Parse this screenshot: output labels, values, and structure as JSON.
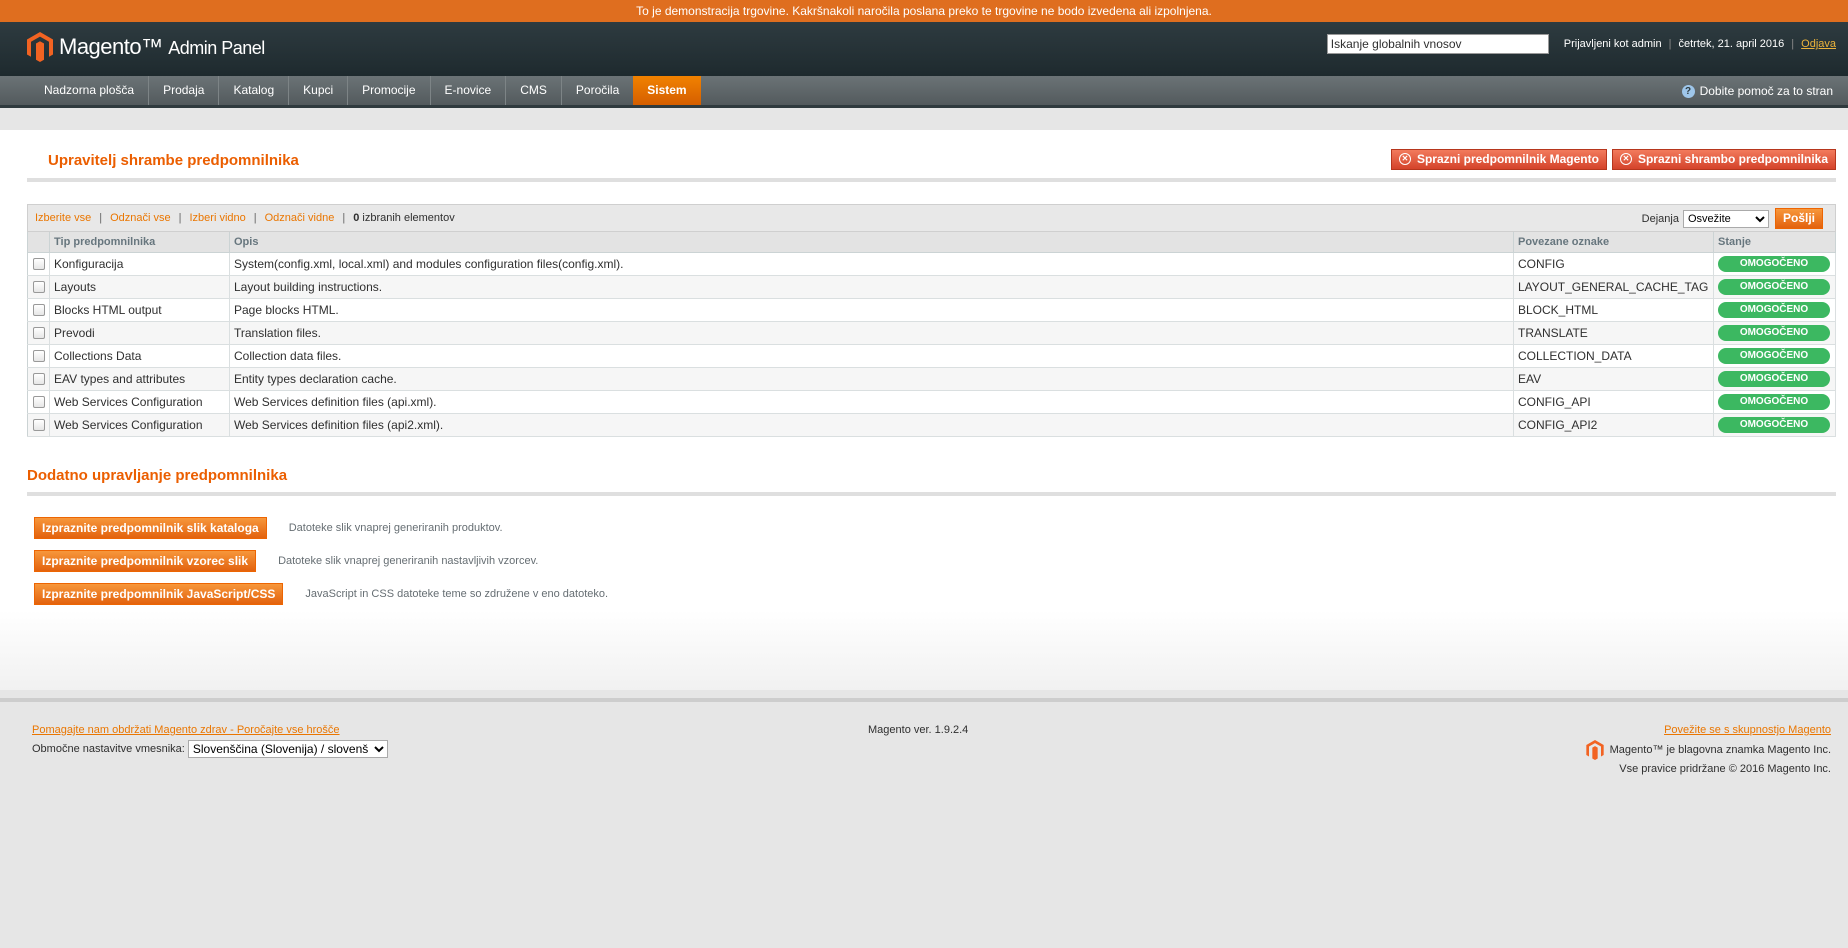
{
  "demo_notice": "To je demonstracija trgovine. Kakršnakoli naročila poslana preko te trgovine ne bodo izvedena ali izpolnjena.",
  "header": {
    "logo_brand": "Magento",
    "logo_sub": "Admin Panel",
    "search_value": "Iskanje globalnih vnosov",
    "logged_in": "Prijavljeni kot admin",
    "date": "četrtek, 21. april 2016",
    "logout": "Odjava"
  },
  "nav": {
    "items": [
      "Nadzorna plošča",
      "Prodaja",
      "Katalog",
      "Kupci",
      "Promocije",
      "E-novice",
      "CMS",
      "Poročila",
      "Sistem"
    ],
    "active": "Sistem",
    "help": "Dobite pomoč za to stran"
  },
  "page": {
    "title": "Upravitelj shrambe predpomnilnika",
    "flush_magento": "Sprazni predpomnilnik Magento",
    "flush_storage": "Sprazni shrambo predpomnilnika"
  },
  "massaction": {
    "select_all": "Izberite vse",
    "unselect_all": "Odznači vse",
    "select_visible": "Izberi vidno",
    "unselect_visible": "Odznači vidne",
    "count": "0",
    "count_label": "izbranih elementov",
    "actions_label": "Dejanja",
    "action_value": "Osvežite",
    "submit": "Pošlji"
  },
  "grid": {
    "columns": [
      "",
      "Tip predpomnilnika",
      "Opis",
      "Povezane oznake",
      "Stanje"
    ],
    "rows": [
      {
        "type": "Konfiguracija",
        "desc": "System(config.xml, local.xml) and modules configuration files(config.xml).",
        "tags": "CONFIG",
        "status": "OMOGOČENO"
      },
      {
        "type": "Layouts",
        "desc": "Layout building instructions.",
        "tags": "LAYOUT_GENERAL_CACHE_TAG",
        "status": "OMOGOČENO"
      },
      {
        "type": "Blocks HTML output",
        "desc": "Page blocks HTML.",
        "tags": "BLOCK_HTML",
        "status": "OMOGOČENO"
      },
      {
        "type": "Prevodi",
        "desc": "Translation files.",
        "tags": "TRANSLATE",
        "status": "OMOGOČENO"
      },
      {
        "type": "Collections Data",
        "desc": "Collection data files.",
        "tags": "COLLECTION_DATA",
        "status": "OMOGOČENO"
      },
      {
        "type": "EAV types and attributes",
        "desc": "Entity types declaration cache.",
        "tags": "EAV",
        "status": "OMOGOČENO"
      },
      {
        "type": "Web Services Configuration",
        "desc": "Web Services definition files (api.xml).",
        "tags": "CONFIG_API",
        "status": "OMOGOČENO"
      },
      {
        "type": "Web Services Configuration",
        "desc": "Web Services definition files (api2.xml).",
        "tags": "CONFIG_API2",
        "status": "OMOGOČENO"
      }
    ]
  },
  "additional": {
    "title": "Dodatno upravljanje predpomnilnika",
    "rows": [
      {
        "button": "Izpraznite predpomnilnik slik kataloga",
        "desc": "Datoteke slik vnaprej generiranih produktov."
      },
      {
        "button": "Izpraznite predpomnilnik vzorec slik",
        "desc": "Datoteke slik vnaprej generiranih nastavljivih vzorcev."
      },
      {
        "button": "Izpraznite predpomnilnik JavaScript/CSS",
        "desc": "JavaScript in CSS datoteke teme so združene v eno datoteko."
      }
    ]
  },
  "footer": {
    "bug_link": "Pomagajte nam obdržati Magento zdrav - Poročajte vse hrošče",
    "locale_label": "Območne nastavitve vmesnika:",
    "locale_value": "Slovenščina (Slovenija) / slovenš",
    "version": "Magento ver. 1.9.2.4",
    "community_link": "Povežite se s skupnostjo Magento",
    "trademark": "Magento™ je blagovna znamka Magento Inc.",
    "copyright": "Vse pravice pridržane © 2016 Magento Inc."
  },
  "colors": {
    "accent": "#eb5e00",
    "status_enabled": "#3cb861",
    "demo_bar": "#df6e1f"
  }
}
